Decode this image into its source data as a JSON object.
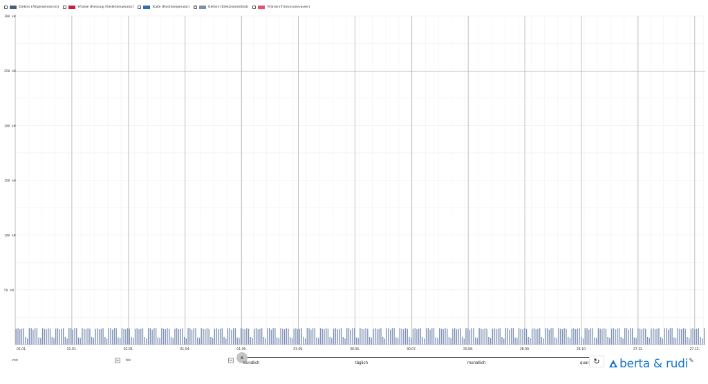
{
  "legend": [
    {
      "label": "Elektro (Allgemeinstrom)",
      "color": "#4a5f80",
      "checked": false
    },
    {
      "label": "Wärme (Heizung Niedertemperatur)",
      "color": "#c6213d",
      "checked": false
    },
    {
      "label": "Kälte (Hochtemperatur)",
      "color": "#2f6fb0",
      "checked": false
    },
    {
      "label": "Elektro (Elektromobilität)",
      "color": "#7c8fb4",
      "checked": true
    },
    {
      "label": "Wärme (Trinkwarmwasser)",
      "color": "#e84f6b",
      "checked": false
    }
  ],
  "chart_data": {
    "type": "bar",
    "series": [
      {
        "name": "Elektro (Elektromobilität)",
        "color": "#7c8fb4",
        "values_kw": "daily series (generated below, range ~6–15 kW)",
        "min": 6,
        "max": 15
      }
    ],
    "y_ticks": [
      "50 kW",
      "100 kW",
      "150 kW",
      "200 kW",
      "250 kW",
      "300 kW"
    ],
    "ylim": [
      0,
      300
    ],
    "x_ticks": [
      "01.01.",
      "31.01.",
      "02.03.",
      "01.04.",
      "01.05.",
      "31.05.",
      "30.06.",
      "30.07.",
      "29.08.",
      "28.09.",
      "28.10.",
      "27.11.",
      "27.12."
    ],
    "grid": true
  },
  "controls": {
    "from_label": "von",
    "to_label": "bis",
    "resolutions": [
      "stündlich",
      "täglich",
      "monatlich",
      "quar"
    ],
    "reset_icon": "reset-icon",
    "logo_text": "berta & rudi",
    "pin_icon": "pin-icon"
  }
}
